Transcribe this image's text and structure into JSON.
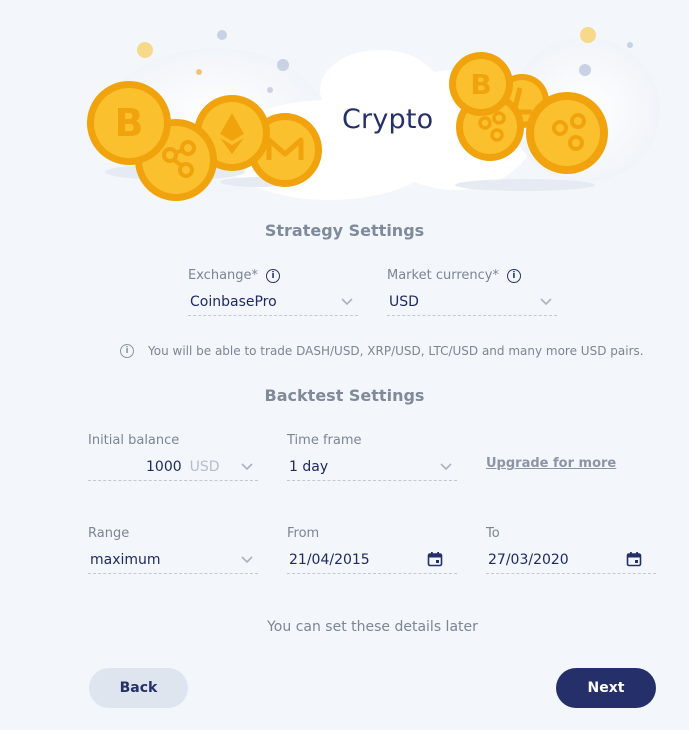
{
  "hero": {
    "title": "Crypto"
  },
  "strategy": {
    "title": "Strategy Settings",
    "exchange": {
      "label": "Exchange*",
      "value": "CoinbasePro"
    },
    "market_currency": {
      "label": "Market currency*",
      "value": "USD"
    },
    "notice": "You will be able to trade DASH/USD, XRP/USD, LTC/USD and many more USD pairs."
  },
  "backtest": {
    "title": "Backtest Settings",
    "initial_balance": {
      "label": "Initial balance",
      "value": "1000",
      "currency": "USD"
    },
    "time_frame": {
      "label": "Time frame",
      "value": "1 day"
    },
    "upgrade_link": "Upgrade for more",
    "range": {
      "label": "Range",
      "value": "maximum"
    },
    "from": {
      "label": "From",
      "value": "21/04/2015"
    },
    "to": {
      "label": "To",
      "value": "27/03/2020"
    }
  },
  "footer": {
    "note": "You can set these details later",
    "back_label": "Back",
    "next_label": "Next"
  },
  "colors": {
    "primary": "#25306b",
    "coin": "#fbc02d",
    "coin_dark": "#f1a30e",
    "background": "#f3f6fb"
  },
  "icons": [
    "bitcoin-coin-icon",
    "ripple-coin-icon",
    "ethereum-coin-icon",
    "monero-coin-icon",
    "litecoin-coin-icon",
    "info-icon",
    "chevron-down-icon",
    "calendar-icon"
  ]
}
